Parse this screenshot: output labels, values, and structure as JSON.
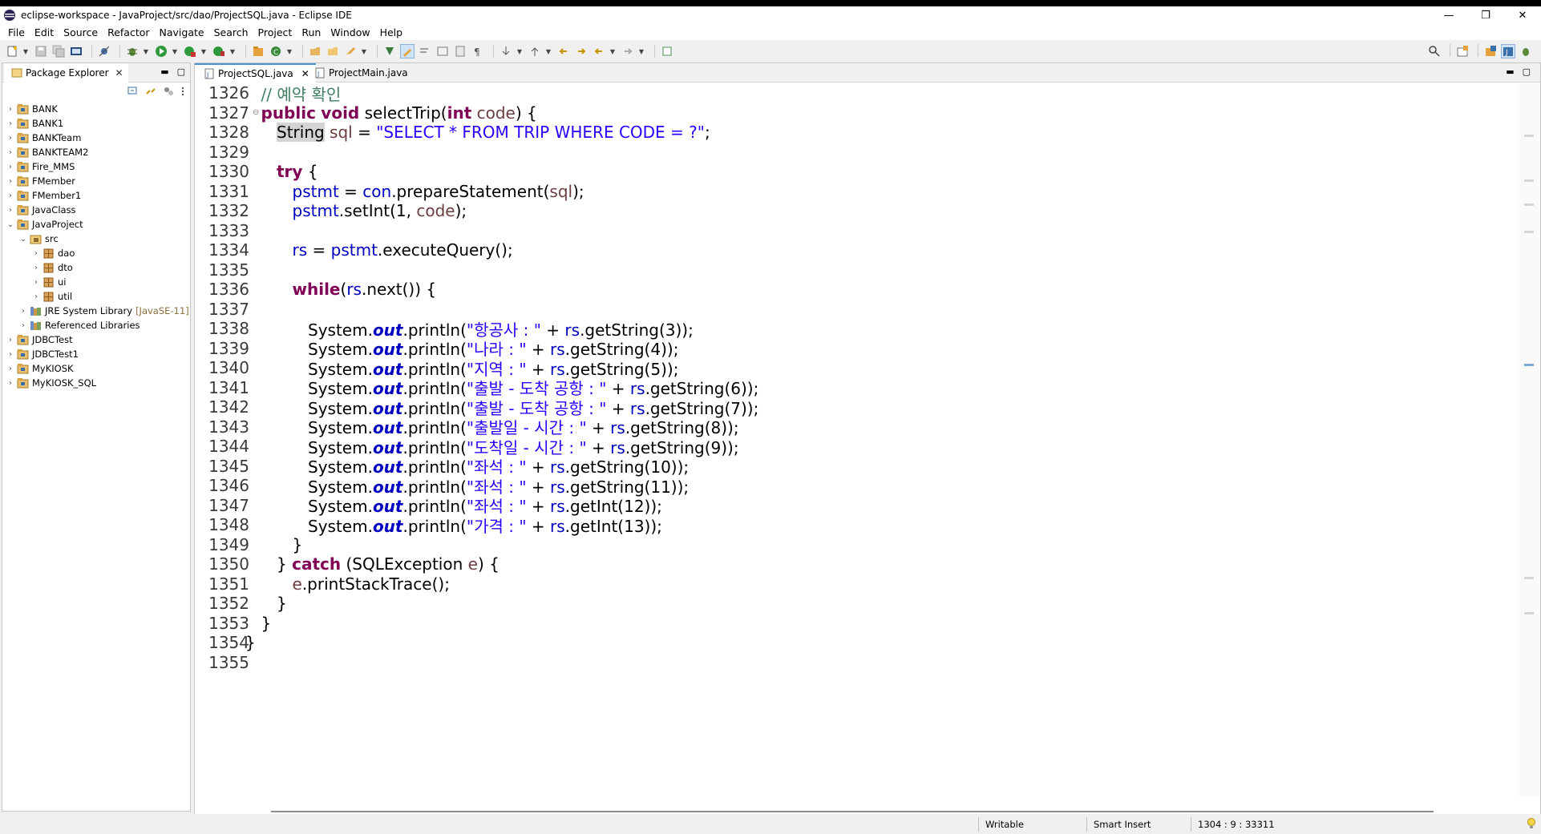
{
  "window": {
    "title": "eclipse-workspace - JavaProject/src/dao/ProjectSQL.java - Eclipse IDE",
    "controls": [
      "—",
      "❐",
      "✕"
    ]
  },
  "menu": [
    "File",
    "Edit",
    "Source",
    "Refactor",
    "Navigate",
    "Search",
    "Project",
    "Run",
    "Window",
    "Help"
  ],
  "package_explorer": {
    "title": "Package Explorer",
    "tree": [
      {
        "label": "BANK",
        "indent": 0,
        "kind": "project",
        "expanded": false
      },
      {
        "label": "BANK1",
        "indent": 0,
        "kind": "project",
        "expanded": false
      },
      {
        "label": "BANKTeam",
        "indent": 0,
        "kind": "project",
        "expanded": false
      },
      {
        "label": "BANKTEAM2",
        "indent": 0,
        "kind": "project",
        "expanded": false
      },
      {
        "label": "Fire_MMS",
        "indent": 0,
        "kind": "project",
        "expanded": false
      },
      {
        "label": "FMember",
        "indent": 0,
        "kind": "project",
        "expanded": false
      },
      {
        "label": "FMember1",
        "indent": 0,
        "kind": "project",
        "expanded": false
      },
      {
        "label": "JavaClass",
        "indent": 0,
        "kind": "project",
        "expanded": false
      },
      {
        "label": "JavaProject",
        "indent": 0,
        "kind": "project",
        "expanded": true
      },
      {
        "label": "src",
        "indent": 1,
        "kind": "srcfolder",
        "expanded": true
      },
      {
        "label": "dao",
        "indent": 2,
        "kind": "package",
        "expanded": false
      },
      {
        "label": "dto",
        "indent": 2,
        "kind": "package",
        "expanded": false
      },
      {
        "label": "ui",
        "indent": 2,
        "kind": "package",
        "expanded": false
      },
      {
        "label": "util",
        "indent": 2,
        "kind": "package",
        "expanded": false
      },
      {
        "label": "JRE System Library",
        "decor": "[JavaSE-11]",
        "indent": 1,
        "kind": "library",
        "expanded": false
      },
      {
        "label": "Referenced Libraries",
        "indent": 1,
        "kind": "library",
        "expanded": false
      },
      {
        "label": "JDBCTest",
        "indent": 0,
        "kind": "project",
        "expanded": false
      },
      {
        "label": "JDBCTest1",
        "indent": 0,
        "kind": "project",
        "expanded": false
      },
      {
        "label": "MyKIOSK",
        "indent": 0,
        "kind": "project",
        "expanded": false
      },
      {
        "label": "MyKIOSK_SQL",
        "indent": 0,
        "kind": "project",
        "expanded": false
      }
    ]
  },
  "editor": {
    "tabs": [
      {
        "label": "ProjectSQL.java",
        "active": true
      },
      {
        "label": "ProjectMain.java",
        "active": false
      }
    ],
    "lines": [
      {
        "n": "1326",
        "indent": 1,
        "tokens": [
          [
            "cmt",
            "// 예약 확인"
          ]
        ]
      },
      {
        "n": "1327",
        "indent": 1,
        "fold": true,
        "tokens": [
          [
            "kw",
            "public"
          ],
          [
            "",
            " "
          ],
          [
            "kw",
            "void"
          ],
          [
            "",
            " selectTrip("
          ],
          [
            "kw",
            "int"
          ],
          [
            "",
            " "
          ],
          [
            "var",
            "code"
          ],
          [
            "",
            ") {"
          ]
        ]
      },
      {
        "n": "1328",
        "indent": 2,
        "tokens": [
          [
            "hl",
            "String"
          ],
          [
            "",
            " "
          ],
          [
            "var",
            "sql"
          ],
          [
            "",
            " = "
          ],
          [
            "str",
            "\"SELECT * FROM TRIP WHERE CODE = ?\""
          ],
          [
            "",
            ";"
          ]
        ]
      },
      {
        "n": "1329",
        "indent": 0,
        "tokens": []
      },
      {
        "n": "1330",
        "indent": 2,
        "tokens": [
          [
            "kw",
            "try"
          ],
          [
            "",
            " {"
          ]
        ]
      },
      {
        "n": "1331",
        "indent": 3,
        "tokens": [
          [
            "fld",
            "pstmt"
          ],
          [
            "",
            " = "
          ],
          [
            "fld",
            "con"
          ],
          [
            "",
            ".prepareStatement("
          ],
          [
            "var",
            "sql"
          ],
          [
            "",
            ");"
          ]
        ]
      },
      {
        "n": "1332",
        "indent": 3,
        "tokens": [
          [
            "fld",
            "pstmt"
          ],
          [
            "",
            ".setInt(1, "
          ],
          [
            "var",
            "code"
          ],
          [
            "",
            ");"
          ]
        ]
      },
      {
        "n": "1333",
        "indent": 0,
        "tokens": []
      },
      {
        "n": "1334",
        "indent": 3,
        "tokens": [
          [
            "fld",
            "rs"
          ],
          [
            "",
            " = "
          ],
          [
            "fld",
            "pstmt"
          ],
          [
            "",
            ".executeQuery();"
          ]
        ]
      },
      {
        "n": "1335",
        "indent": 0,
        "tokens": []
      },
      {
        "n": "1336",
        "indent": 3,
        "tokens": [
          [
            "kw",
            "while"
          ],
          [
            "",
            "("
          ],
          [
            "fld",
            "rs"
          ],
          [
            "",
            ".next()) {"
          ]
        ]
      },
      {
        "n": "1337",
        "indent": 0,
        "tokens": []
      },
      {
        "n": "1338",
        "indent": 4,
        "tokens": [
          [
            "",
            "System."
          ],
          [
            "sfld",
            "out"
          ],
          [
            "",
            ".println("
          ],
          [
            "str",
            "\"항공사 : \""
          ],
          [
            "",
            " + "
          ],
          [
            "fld",
            "rs"
          ],
          [
            "",
            ".getString(3));"
          ]
        ]
      },
      {
        "n": "1339",
        "indent": 4,
        "tokens": [
          [
            "",
            "System."
          ],
          [
            "sfld",
            "out"
          ],
          [
            "",
            ".println("
          ],
          [
            "str",
            "\"나라 : \""
          ],
          [
            "",
            " + "
          ],
          [
            "fld",
            "rs"
          ],
          [
            "",
            ".getString(4));"
          ]
        ]
      },
      {
        "n": "1340",
        "indent": 4,
        "tokens": [
          [
            "",
            "System."
          ],
          [
            "sfld",
            "out"
          ],
          [
            "",
            ".println("
          ],
          [
            "str",
            "\"지역 : \""
          ],
          [
            "",
            " + "
          ],
          [
            "fld",
            "rs"
          ],
          [
            "",
            ".getString(5));"
          ]
        ]
      },
      {
        "n": "1341",
        "indent": 4,
        "tokens": [
          [
            "",
            "System."
          ],
          [
            "sfld",
            "out"
          ],
          [
            "",
            ".println("
          ],
          [
            "str",
            "\"출발 - 도착 공항 : \""
          ],
          [
            "",
            " + "
          ],
          [
            "fld",
            "rs"
          ],
          [
            "",
            ".getString(6));"
          ]
        ]
      },
      {
        "n": "1342",
        "indent": 4,
        "tokens": [
          [
            "",
            "System."
          ],
          [
            "sfld",
            "out"
          ],
          [
            "",
            ".println("
          ],
          [
            "str",
            "\"출발 - 도착 공항 : \""
          ],
          [
            "",
            " + "
          ],
          [
            "fld",
            "rs"
          ],
          [
            "",
            ".getString(7));"
          ]
        ]
      },
      {
        "n": "1343",
        "indent": 4,
        "tokens": [
          [
            "",
            "System."
          ],
          [
            "sfld",
            "out"
          ],
          [
            "",
            ".println("
          ],
          [
            "str",
            "\"출발일 - 시간 : \""
          ],
          [
            "",
            " + "
          ],
          [
            "fld",
            "rs"
          ],
          [
            "",
            ".getString(8));"
          ]
        ]
      },
      {
        "n": "1344",
        "indent": 4,
        "tokens": [
          [
            "",
            "System."
          ],
          [
            "sfld",
            "out"
          ],
          [
            "",
            ".println("
          ],
          [
            "str",
            "\"도착일 - 시간 : \""
          ],
          [
            "",
            " + "
          ],
          [
            "fld",
            "rs"
          ],
          [
            "",
            ".getString(9));"
          ]
        ]
      },
      {
        "n": "1345",
        "indent": 4,
        "tokens": [
          [
            "",
            "System."
          ],
          [
            "sfld",
            "out"
          ],
          [
            "",
            ".println("
          ],
          [
            "str",
            "\"좌석 : \""
          ],
          [
            "",
            " + "
          ],
          [
            "fld",
            "rs"
          ],
          [
            "",
            ".getString(10));"
          ]
        ]
      },
      {
        "n": "1346",
        "indent": 4,
        "tokens": [
          [
            "",
            "System."
          ],
          [
            "sfld",
            "out"
          ],
          [
            "",
            ".println("
          ],
          [
            "str",
            "\"좌석 : \""
          ],
          [
            "",
            " + "
          ],
          [
            "fld",
            "rs"
          ],
          [
            "",
            ".getString(11));"
          ]
        ]
      },
      {
        "n": "1347",
        "indent": 4,
        "tokens": [
          [
            "",
            "System."
          ],
          [
            "sfld",
            "out"
          ],
          [
            "",
            ".println("
          ],
          [
            "str",
            "\"좌석 : \""
          ],
          [
            "",
            " + "
          ],
          [
            "fld",
            "rs"
          ],
          [
            "",
            ".getInt(12));"
          ]
        ]
      },
      {
        "n": "1348",
        "indent": 4,
        "tokens": [
          [
            "",
            "System."
          ],
          [
            "sfld",
            "out"
          ],
          [
            "",
            ".println("
          ],
          [
            "str",
            "\"가격 : \""
          ],
          [
            "",
            " + "
          ],
          [
            "fld",
            "rs"
          ],
          [
            "",
            ".getInt(13));"
          ]
        ]
      },
      {
        "n": "1349",
        "indent": 3,
        "tokens": [
          [
            "",
            "}"
          ]
        ]
      },
      {
        "n": "1350",
        "indent": 2,
        "tokens": [
          [
            "",
            "} "
          ],
          [
            "kw",
            "catch"
          ],
          [
            "",
            " (SQLException "
          ],
          [
            "var",
            "e"
          ],
          [
            "",
            ") {"
          ]
        ]
      },
      {
        "n": "1351",
        "indent": 3,
        "tokens": [
          [
            "var",
            "e"
          ],
          [
            "",
            ".printStackTrace();"
          ]
        ]
      },
      {
        "n": "1352",
        "indent": 2,
        "tokens": [
          [
            "",
            "}"
          ]
        ]
      },
      {
        "n": "1353",
        "indent": 1,
        "tokens": [
          [
            "",
            "}"
          ]
        ]
      },
      {
        "n": "1354",
        "indent": 0,
        "tokens": [
          [
            "",
            "}"
          ]
        ]
      },
      {
        "n": "1355",
        "indent": 0,
        "tokens": []
      }
    ]
  },
  "status": {
    "writable": "Writable",
    "insert_mode": "Smart Insert",
    "position": "1304 : 9 : 33311"
  },
  "colors": {
    "keyword": "#7f0055",
    "string": "#2a00ff",
    "comment": "#3f7f5f",
    "field": "#0000c0",
    "local_variable": "#6a3e3e"
  }
}
